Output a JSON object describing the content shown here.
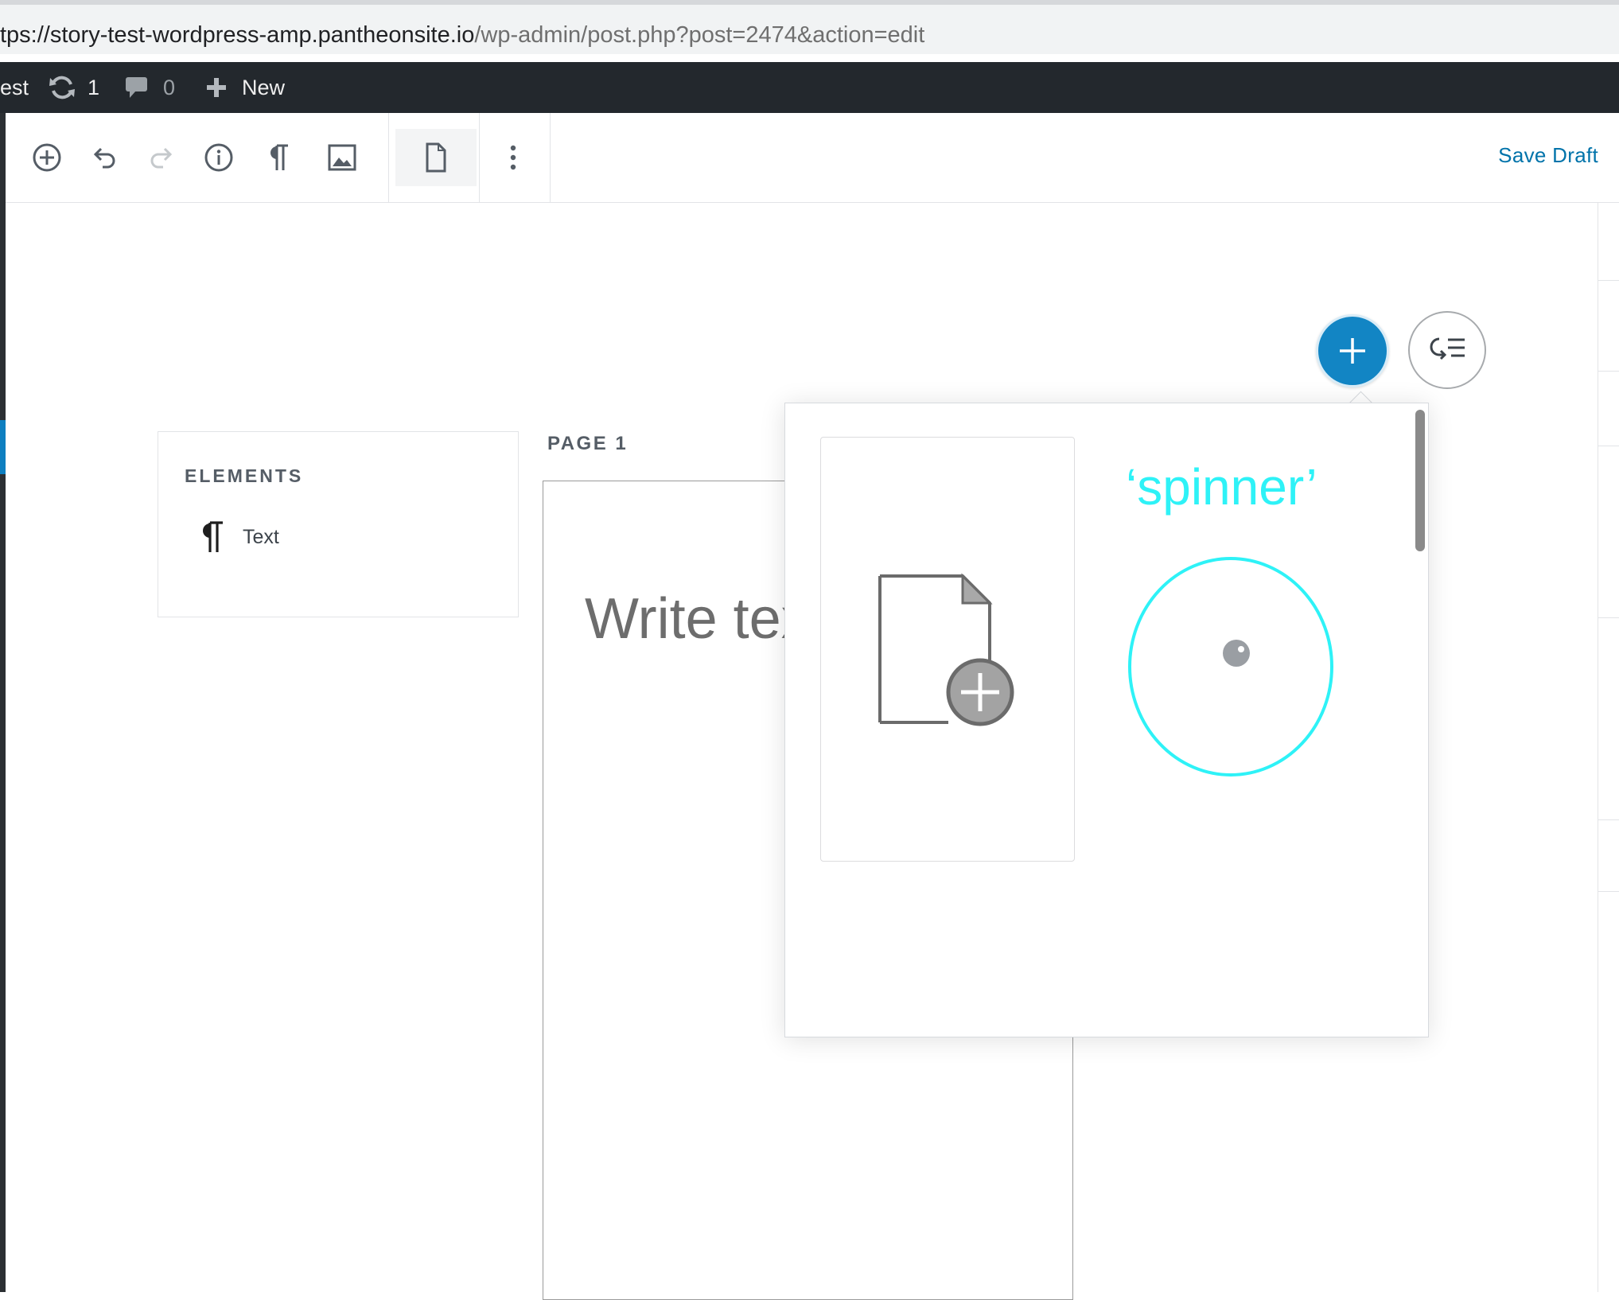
{
  "browser": {
    "url_host": "tps://story-test-wordpress-amp.pantheonsite.io",
    "url_path": "/wp-admin/post.php?post=2474&action=edit"
  },
  "admin_bar": {
    "site_name": "est",
    "updates_count": "1",
    "comments_count": "0",
    "new_label": "New"
  },
  "toolbar": {
    "tools": [
      "add-block-icon",
      "undo-icon",
      "redo-icon",
      "info-icon",
      "paragraph-icon",
      "image-icon",
      "page-icon",
      "more-vertical-icon"
    ],
    "save_draft_label": "Save Draft"
  },
  "elements_panel": {
    "title": "ELEMENTS",
    "items": [
      {
        "icon": "paragraph-icon",
        "label": "Text"
      }
    ]
  },
  "page": {
    "label": "PAGE 1",
    "placeholder": "Write text"
  },
  "popover": {
    "template_icon": "add-page-icon",
    "annotation": "‘spinner’"
  },
  "colors": {
    "accent": "#1285c4",
    "link": "#0073aa",
    "admin_bar": "#23282d",
    "annotation": "#2ef2f7"
  }
}
